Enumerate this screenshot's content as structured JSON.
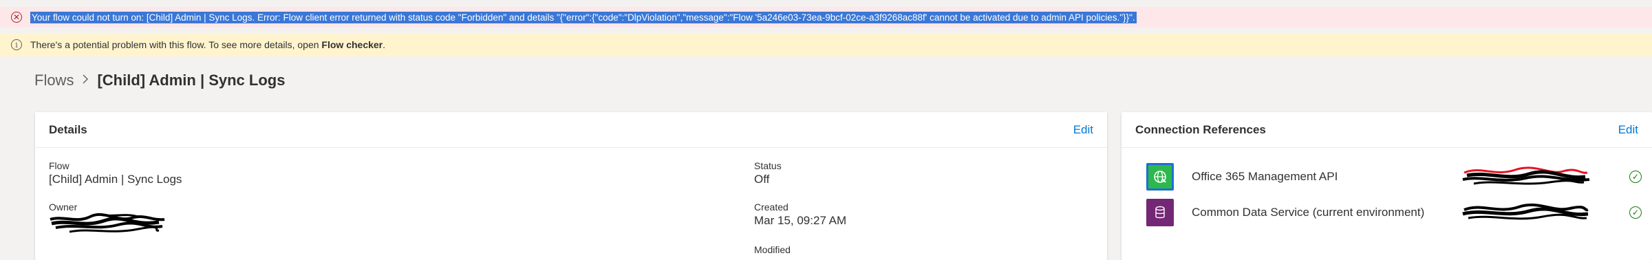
{
  "error_bar": {
    "icon": "error-circle-icon",
    "message": "Your flow could not turn on: [Child] Admin | Sync Logs. Error: Flow client error returned with status code \"Forbidden\" and details \"{\"error\":{\"code\":\"DlpViolation\",\"message\":\"Flow '5a246e03-73ea-9bcf-02ce-a3f9268ac88f' cannot be activated due to admin API policies.\"}}\"."
  },
  "warning_bar": {
    "icon": "info-icon",
    "text": "There's a potential problem with this flow. To see more details, open ",
    "link": "Flow checker",
    "suffix": "."
  },
  "breadcrumb": {
    "root": "Flows",
    "separator": ">",
    "current": "[Child] Admin | Sync Logs"
  },
  "details": {
    "title": "Details",
    "edit_label": "Edit",
    "flow_label": "Flow",
    "flow_value": "[Child] Admin | Sync Logs",
    "owner_label": "Owner",
    "status_label": "Status",
    "status_value": "Off",
    "created_label": "Created",
    "created_value": "Mar 15, 09:27 AM",
    "modified_label": "Modified"
  },
  "connections": {
    "title": "Connection References",
    "edit_label": "Edit",
    "items": [
      {
        "name": "Office 365 Management API",
        "icon": "office365-management-icon",
        "icon_color": "#2db84d",
        "status_icon": "check-circle-icon"
      },
      {
        "name": "Common Data Service (current environment)",
        "icon": "database-icon",
        "icon_color": "#742774",
        "status_icon": "check-circle-icon"
      }
    ]
  },
  "colors": {
    "error_bg": "#fde7e9",
    "warning_bg": "#fff4ce",
    "link_blue": "#0078d4",
    "success_green": "#107c10"
  }
}
